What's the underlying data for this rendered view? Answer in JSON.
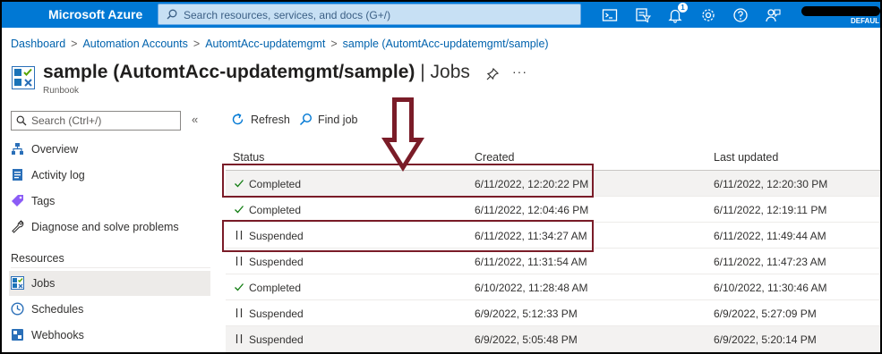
{
  "topbar": {
    "brand": "Microsoft Azure",
    "search_placeholder": "Search resources, services, and docs (G+/)",
    "notification_count": "1",
    "directory_label": "DEFAUL"
  },
  "breadcrumb": [
    "Dashboard",
    "Automation Accounts",
    "AutomtAcc-updatemgmt",
    "sample (AutomtAcc-updatemgmt/sample)"
  ],
  "page": {
    "title": "sample (AutomtAcc-updatemgmt/sample)",
    "title_suffix": "| Jobs",
    "subtitle": "Runbook",
    "more": "···"
  },
  "sidebar": {
    "search_placeholder": "Search (Ctrl+/)",
    "collapse": "«",
    "items": [
      {
        "label": "Overview",
        "icon": "overview-icon"
      },
      {
        "label": "Activity log",
        "icon": "activity-log-icon"
      },
      {
        "label": "Tags",
        "icon": "tag-icon"
      },
      {
        "label": "Diagnose and solve problems",
        "icon": "wrench-icon"
      }
    ],
    "section": "Resources",
    "resources": [
      {
        "label": "Jobs",
        "icon": "jobs-icon",
        "active": true
      },
      {
        "label": "Schedules",
        "icon": "clock-icon"
      },
      {
        "label": "Webhooks",
        "icon": "webhook-icon"
      }
    ]
  },
  "toolbar": {
    "refresh": "Refresh",
    "find_job": "Find job"
  },
  "table": {
    "headers": {
      "status": "Status",
      "created": "Created",
      "updated": "Last updated"
    },
    "rows": [
      {
        "status": "Completed",
        "created": "6/11/2022, 12:20:22 PM",
        "updated": "6/11/2022, 12:20:30 PM"
      },
      {
        "status": "Completed",
        "created": "6/11/2022, 12:04:46 PM",
        "updated": "6/11/2022, 12:19:11 PM"
      },
      {
        "status": "Suspended",
        "created": "6/11/2022, 11:34:27 AM",
        "updated": "6/11/2022, 11:49:44 AM"
      },
      {
        "status": "Suspended",
        "created": "6/11/2022, 11:31:54 AM",
        "updated": "6/11/2022, 11:47:23 AM"
      },
      {
        "status": "Completed",
        "created": "6/10/2022, 11:28:48 AM",
        "updated": "6/10/2022, 11:30:46 AM"
      },
      {
        "status": "Suspended",
        "created": "6/9/2022, 5:12:33 PM",
        "updated": "6/9/2022, 5:27:09 PM"
      },
      {
        "status": "Suspended",
        "created": "6/9/2022, 5:05:48 PM",
        "updated": "6/9/2022, 5:20:14 PM"
      }
    ]
  },
  "colors": {
    "azure_blue": "#0078d4",
    "completed_green": "#107c10",
    "annotation_red": "#7a1c28"
  }
}
